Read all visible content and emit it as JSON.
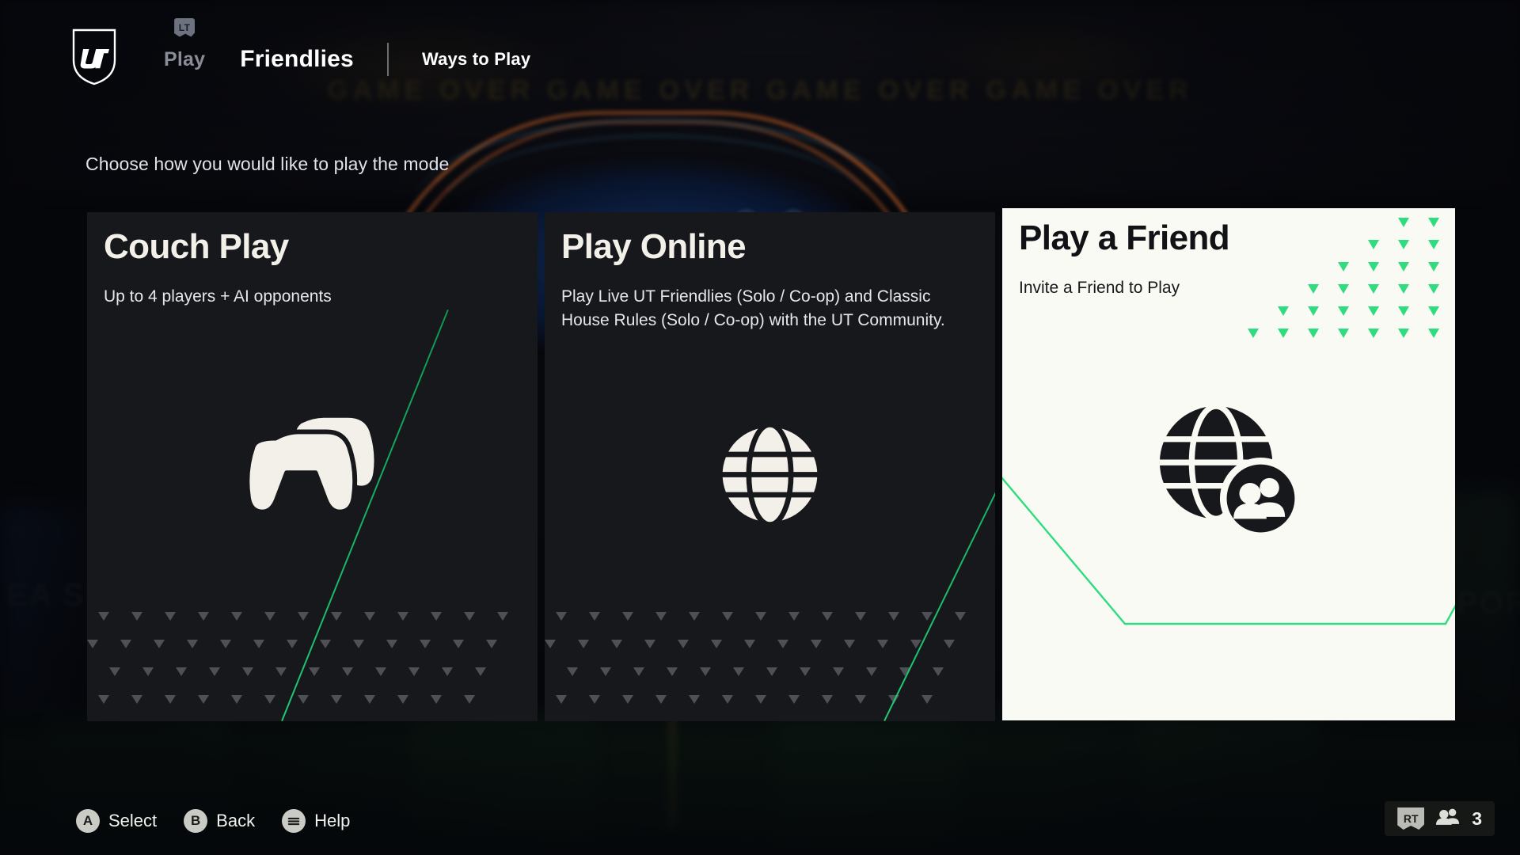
{
  "header": {
    "logo_alt": "UT",
    "nav": [
      {
        "label": "Play",
        "trigger": "LT",
        "state": "inactive"
      },
      {
        "label": "Friendlies",
        "state": "active"
      },
      {
        "label": "Ways to Play",
        "state": "plain"
      }
    ]
  },
  "page": {
    "subtitle": "Choose how you would like to play the mode"
  },
  "cards": [
    {
      "title": "Couch Play",
      "description": "Up to 4 players + AI opponents",
      "icon": "controllers-icon",
      "selected": false
    },
    {
      "title": "Play Online",
      "description": "Play Live UT Friendlies (Solo / Co-op) and Classic House Rules (Solo / Co-op) with the UT Community.",
      "icon": "globe-icon",
      "selected": false
    },
    {
      "title": "Play a Friend",
      "description": "Invite a Friend to Play",
      "icon": "globe-friends-icon",
      "selected": true
    }
  ],
  "footer": {
    "actions": [
      {
        "button": "A",
        "label": "Select",
        "glyph": "A"
      },
      {
        "button": "B",
        "label": "Back",
        "glyph": "B"
      },
      {
        "button": "Menu",
        "label": "Help",
        "glyph": "menu-icon"
      }
    ],
    "status": {
      "trigger": "RT",
      "friends_icon": "people-icon",
      "friends_count": "3"
    }
  },
  "colors": {
    "accent_green": "#2fdc7f",
    "selected_card_bg": "#fafaf4",
    "dark_card_bg": "#17181b",
    "text_light": "#f2f0e9",
    "text_dark": "#111215",
    "inactive_nav": "#8a8c98",
    "banner_orange": "#d7692d",
    "banner_blue": "#143a6e"
  },
  "background": {
    "crowd_text": "GAME  OVER   GAME  OVER   GAME  OVER   GAME  OVER",
    "ghost_left": "EA SPORTS",
    "ghost_right": "EA SPORTS"
  }
}
